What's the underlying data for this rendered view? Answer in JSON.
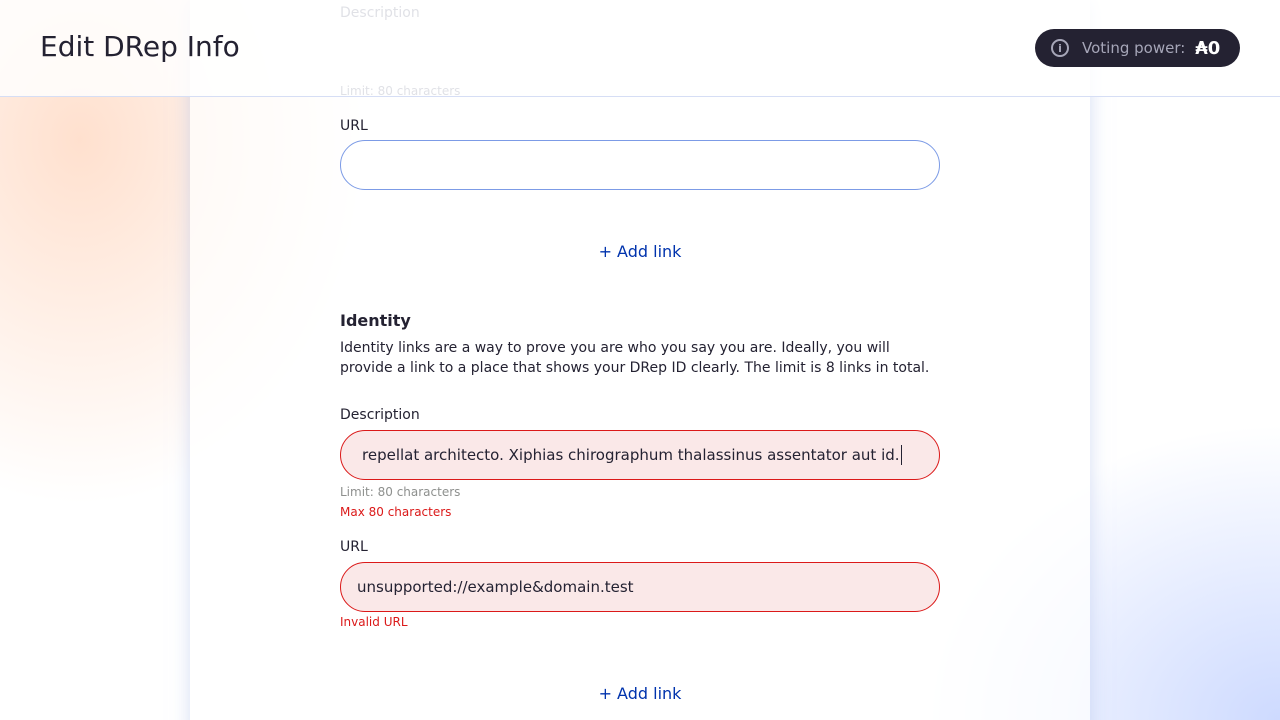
{
  "header": {
    "title": "Edit DRep Info",
    "voting_power_label": "Voting power:",
    "voting_power_value": "₳0"
  },
  "prev_link": {
    "description_label": "Description",
    "limit_hint": "Limit: 80 characters",
    "url_label": "URL",
    "url_value": ""
  },
  "add_link_label": "+ Add link",
  "identity": {
    "title": "Identity",
    "text": "Identity links are a way to prove you are who you say you are. Ideally, you will provide a link to a place that shows your DRep ID clearly. The limit is 8 links in total.",
    "description_label": "Description",
    "description_value": "repellat architecto. Xiphias chirographum thalassinus assentator aut id.",
    "limit_hint": "Limit: 80 characters",
    "description_error": "Max 80 characters",
    "url_label": "URL",
    "url_value": "unsupported://example&domain.test",
    "url_error": "Invalid URL"
  },
  "colors": {
    "accent": "#0033ad",
    "error": "#db1919",
    "error_bg": "#fae8e8",
    "focus_border": "#7c9be6",
    "dark": "#242232"
  }
}
